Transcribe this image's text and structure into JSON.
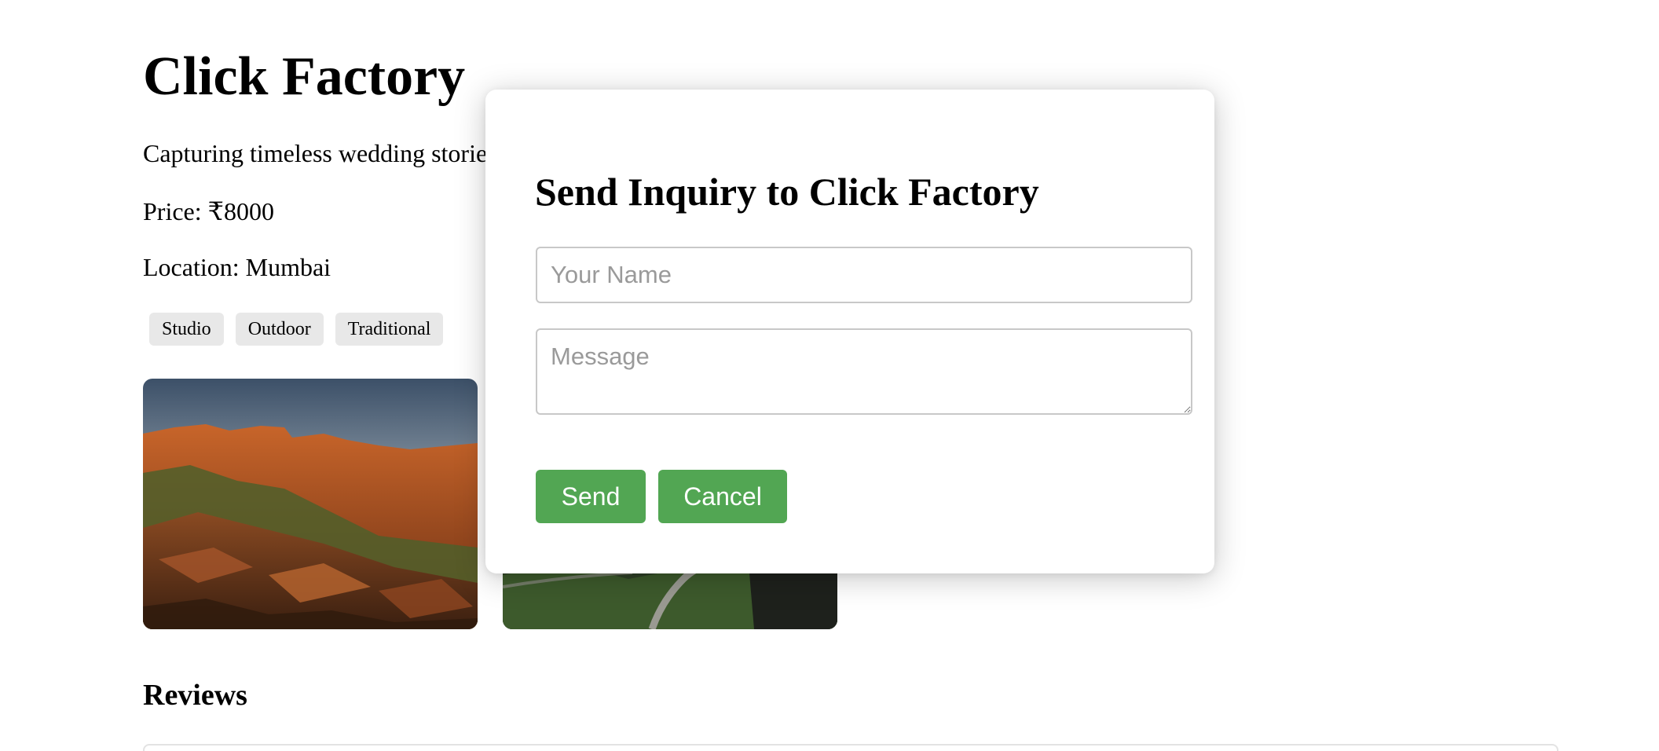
{
  "studio": {
    "name": "Click Factory",
    "tagline": "Capturing timeless wedding storie",
    "price": "Price: ₹8000",
    "location": "Location: Mumbai",
    "tags": [
      "Studio",
      "Outdoor",
      "Traditional"
    ]
  },
  "gallery": {
    "photos": [
      "canyon-rock-landscape-photo",
      "mountain-road-landscape-photo"
    ]
  },
  "reviews": {
    "heading": "Reviews"
  },
  "modal": {
    "title": "Send Inquiry to Click Factory",
    "name_placeholder": "Your Name",
    "message_placeholder": "Message",
    "send_label": "Send",
    "cancel_label": "Cancel"
  },
  "colors": {
    "button_green": "#52a653",
    "tag_background": "#e8e8e8"
  }
}
